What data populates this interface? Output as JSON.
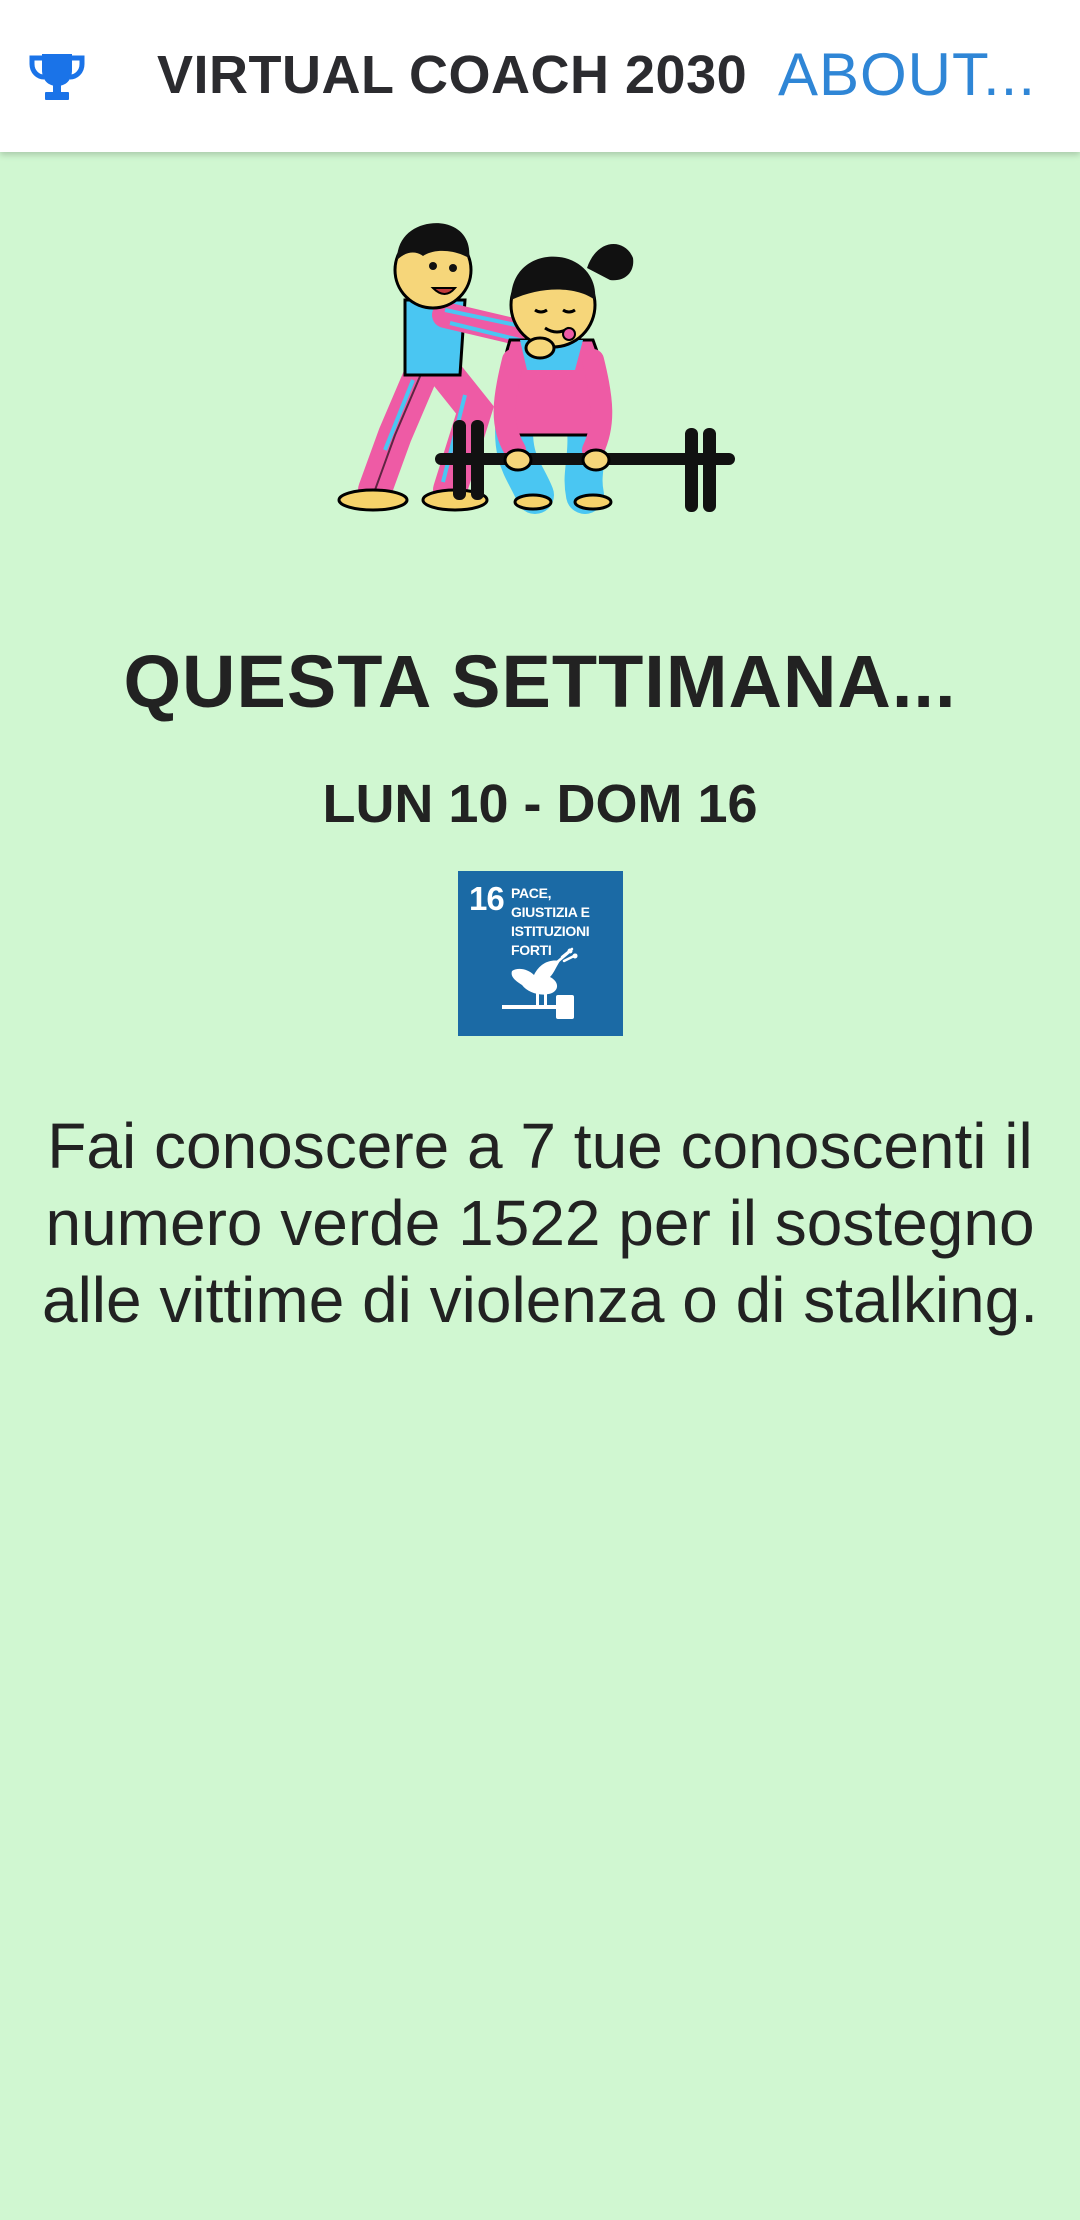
{
  "appbar": {
    "icon": "trophy-icon",
    "title": "VIRTUAL COACH 2030",
    "about_label": "ABOUT..."
  },
  "hero": {
    "illustration": "coach-and-weightlifter-illustration"
  },
  "week": {
    "title": "QUESTA SETTIMANA...",
    "range": "LUN 10 - DOM 16"
  },
  "sdg": {
    "number": "16",
    "label": "PACE, GIUSTIZIA E ISTITUZIONI FORTI",
    "icon": "dove-gavel-icon",
    "color": "#1b6aa5"
  },
  "challenge": {
    "text": "Fai conoscere a 7 tue conoscenti il numero verde 1522 per il sostegno alle vittime di violenza o di stalking."
  },
  "colors": {
    "background": "#d0f7d1",
    "accent": "#2f86d6",
    "trophy": "#1a73e8"
  }
}
